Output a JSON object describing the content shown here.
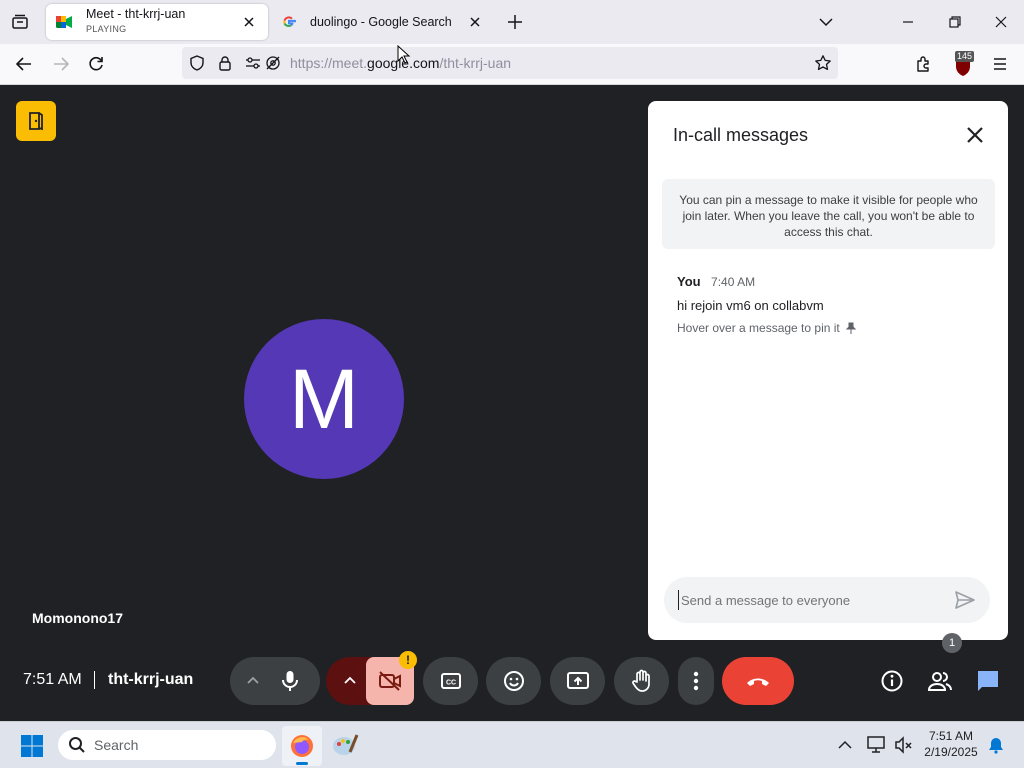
{
  "browser": {
    "tabs": [
      {
        "title": "Meet - tht-krrj-uan",
        "subtitle": "PLAYING",
        "icon": "google-meet-icon",
        "active": true
      },
      {
        "title": "duolingo - Google Search",
        "icon": "google-g-icon",
        "active": false
      }
    ],
    "url_scheme": "https://meet.",
    "url_domain": "google.com",
    "url_path": "/tht-krrj-uan",
    "extension_badge": "145"
  },
  "meet": {
    "avatar_letter": "M",
    "participant_name": "Momonono17",
    "time": "7:51 AM",
    "meeting_code": "tht-krrj-uan",
    "people_count": "1",
    "warning_badge": "!",
    "colors": {
      "avatar": "#5538b5",
      "end_call": "#ea4335",
      "accent": "#8ab4f8",
      "leave_icon_bg": "#fbbc04"
    }
  },
  "chat": {
    "title": "In-call messages",
    "notice": "You can pin a message to make it visible for people who join later. When you leave the call, you won't be able to access this chat.",
    "messages": [
      {
        "sender": "You",
        "time": "7:40 AM",
        "text": "hi rejoin vm6 on collabvm",
        "hint": "Hover over a message to pin it"
      }
    ],
    "input_placeholder": "Send a message to everyone"
  },
  "taskbar": {
    "search_placeholder": "Search",
    "clock_time": "7:51 AM",
    "clock_date": "2/19/2025"
  }
}
